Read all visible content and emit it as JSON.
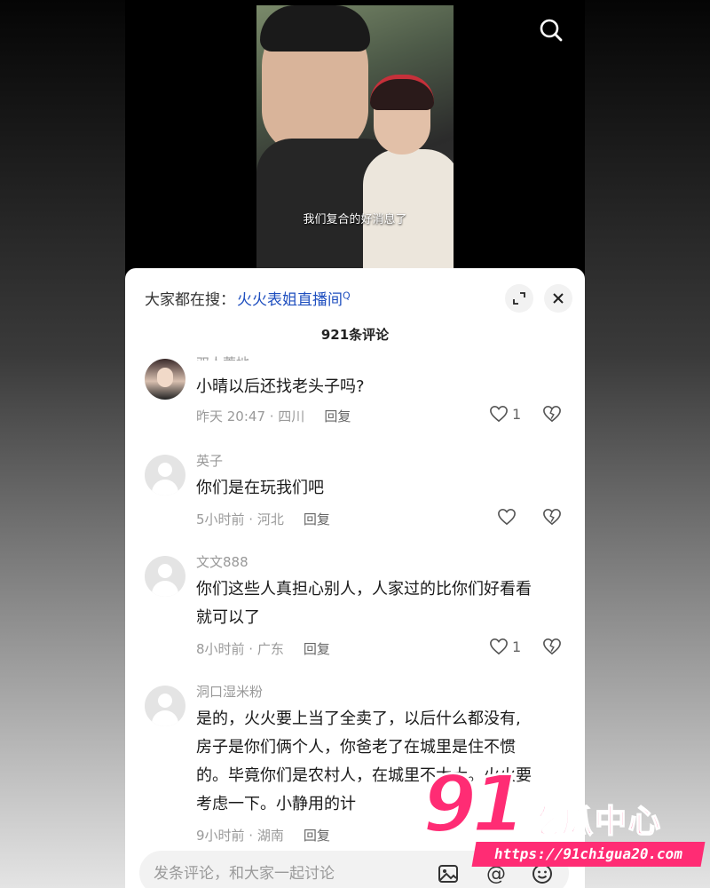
{
  "video": {
    "subtitle": "我们复合的好消息了"
  },
  "header": {
    "trending_prefix": "大家都在搜：",
    "trending_term": "火火表姐直播间",
    "search_glyph": "Q"
  },
  "comment_count": "921条评论",
  "comments": [
    {
      "name": "双人蓄地",
      "text": [
        "小晴以后还找老头子吗?"
      ],
      "time": "昨天 20:47 · 四川",
      "reply": "回复",
      "likes": "1"
    },
    {
      "name": "英子",
      "text": [
        "你们是在玩我们吧"
      ],
      "time": "5小时前 · 河北",
      "reply": "回复",
      "likes": ""
    },
    {
      "name": "文文888",
      "text": [
        "你们这些人真担心别人，人家过的比你们好看看",
        "就可以了"
      ],
      "time": "8小时前 · 广东",
      "reply": "回复",
      "likes": "1"
    },
    {
      "name": "洞口湿米粉",
      "text": [
        "是的，火火要上当了全卖了，以后什么都没有,",
        "房子是你们俩个人，你爸老了在城里是住不惯",
        "的。毕竟你们是农村人，在城里不太大。火火要",
        "考虑一下。小静用的计"
      ],
      "time": "9小时前 · 湖南",
      "reply": "回复",
      "likes": ""
    }
  ],
  "input": {
    "placeholder": "发条评论，和大家一起讨论",
    "at_symbol": "@"
  },
  "watermark": {
    "logo": "91",
    "name": "吃瓜中心",
    "url": "https://91chigua20.com"
  },
  "colors": {
    "link": "#1f4fbf",
    "watermark": "#ff2c74"
  }
}
